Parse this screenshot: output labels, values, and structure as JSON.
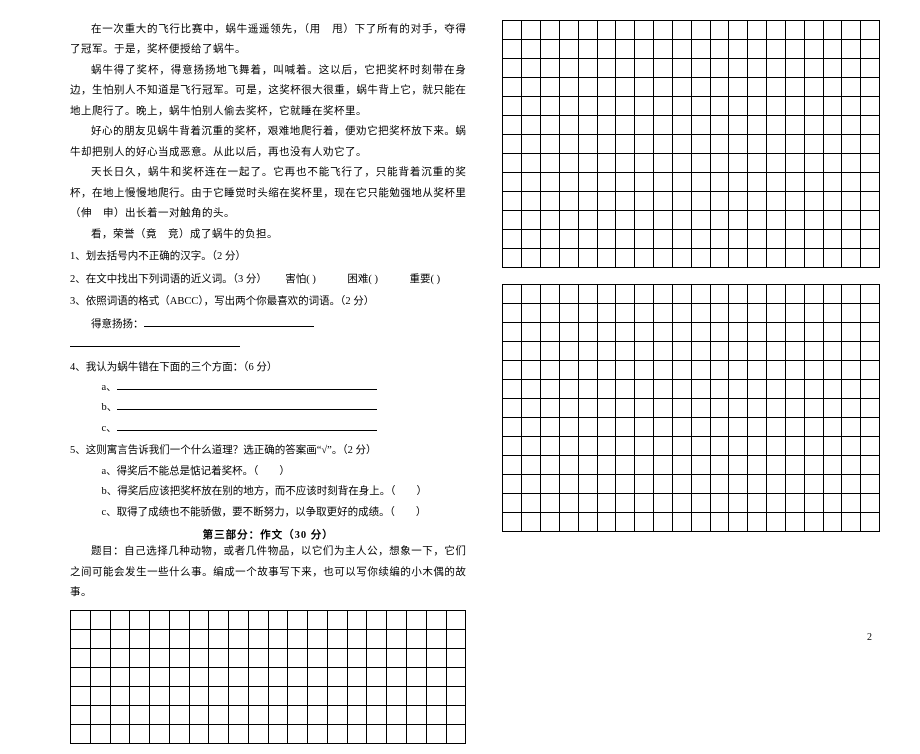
{
  "passage": {
    "p1": "在一次重大的飞行比赛中，蜗牛遥遥领先，（用　甩）下了所有的对手，夺得了冠军。于是，奖杯便授给了蜗牛。",
    "p2": "蜗牛得了奖杯，得意扬扬地飞舞着，叫喊着。这以后，它把奖杯时刻带在身边，生怕别人不知道是飞行冠军。可是，这奖杯很大很重，蜗牛背上它，就只能在地上爬行了。晚上，蜗牛怕别人偷去奖杯，它就睡在奖杯里。",
    "p3": "好心的朋友见蜗牛背着沉重的奖杯，艰难地爬行着，便劝它把奖杯放下来。蜗牛却把别人的好心当成恶意。从此以后，再也没有人劝它了。",
    "p4": "天长日久，蜗牛和奖杯连在一起了。它再也不能飞行了，只能背着沉重的奖杯，在地上慢慢地爬行。由于它睡觉时头缩在奖杯里，现在它只能勉强地从奖杯里（伸　申）出长着一对触角的头。",
    "p5": "看，荣誉（竟　竞）成了蜗牛的负担。"
  },
  "q1": "1、划去括号内不正确的汉字。（2 分）",
  "q2": {
    "text": "2、在文中找出下列词语的近义词。（3 分）",
    "w1": "害怕(",
    "w2": ")　　　困难(",
    "w3": ")　　　重要(",
    "w4": ")"
  },
  "q3": "3、依照词语的格式（ABCC），写出两个你最喜欢的词语。（2 分）",
  "q3a": "得意扬扬：",
  "q4": "4、我认为蜗牛错在下面的三个方面：（6 分）",
  "q4a": "a、",
  "q4b": "b、",
  "q4c": "c、",
  "q5": "5、这则寓言告诉我们一个什么道理？选正确的答案画“√”。（2 分）",
  "q5a": "a、得奖后不能总是惦记着奖杯。（　　）",
  "q5b": "b、得奖后应该把奖杯放在别的地方，而不应该时刻背在身上。（　　）",
  "q5c": "c、取得了成绩也不能骄傲，要不断努力，以争取更好的成绩。（　　）",
  "section3": "第三部分：作文（30 分）",
  "essay": {
    "prompt": "题目：自己选择几种动物，或者几件物品，以它们为主人公，想象一下，它们之间可能会发生一些什么事。编成一个故事写下来，也可以写你续编的小木偶的故事。"
  },
  "pagenum": "2"
}
